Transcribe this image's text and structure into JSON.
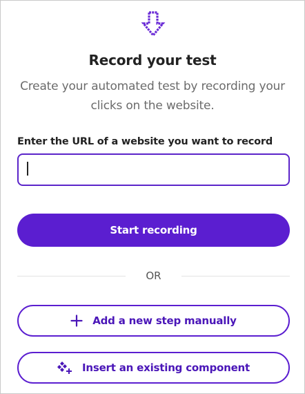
{
  "icons": {
    "hero": "arrow-down-icon",
    "add_step": "plus-icon",
    "insert_component": "component-icon"
  },
  "colors": {
    "accent": "#5b1ed0",
    "accent_text": "#4a16b8",
    "title": "#222222",
    "subtitle": "#6b6b6b",
    "divider": "#e2e2e2"
  },
  "header": {
    "title": "Record your test",
    "subtitle": "Create your automated test by recording your clicks on the website."
  },
  "url_form": {
    "label": "Enter the URL of a website you want to record",
    "value": "",
    "placeholder": ""
  },
  "actions": {
    "start_recording_label": "Start recording",
    "separator_label": "OR",
    "add_step_label": "Add a new step manually",
    "insert_component_label": "Insert an existing component"
  }
}
